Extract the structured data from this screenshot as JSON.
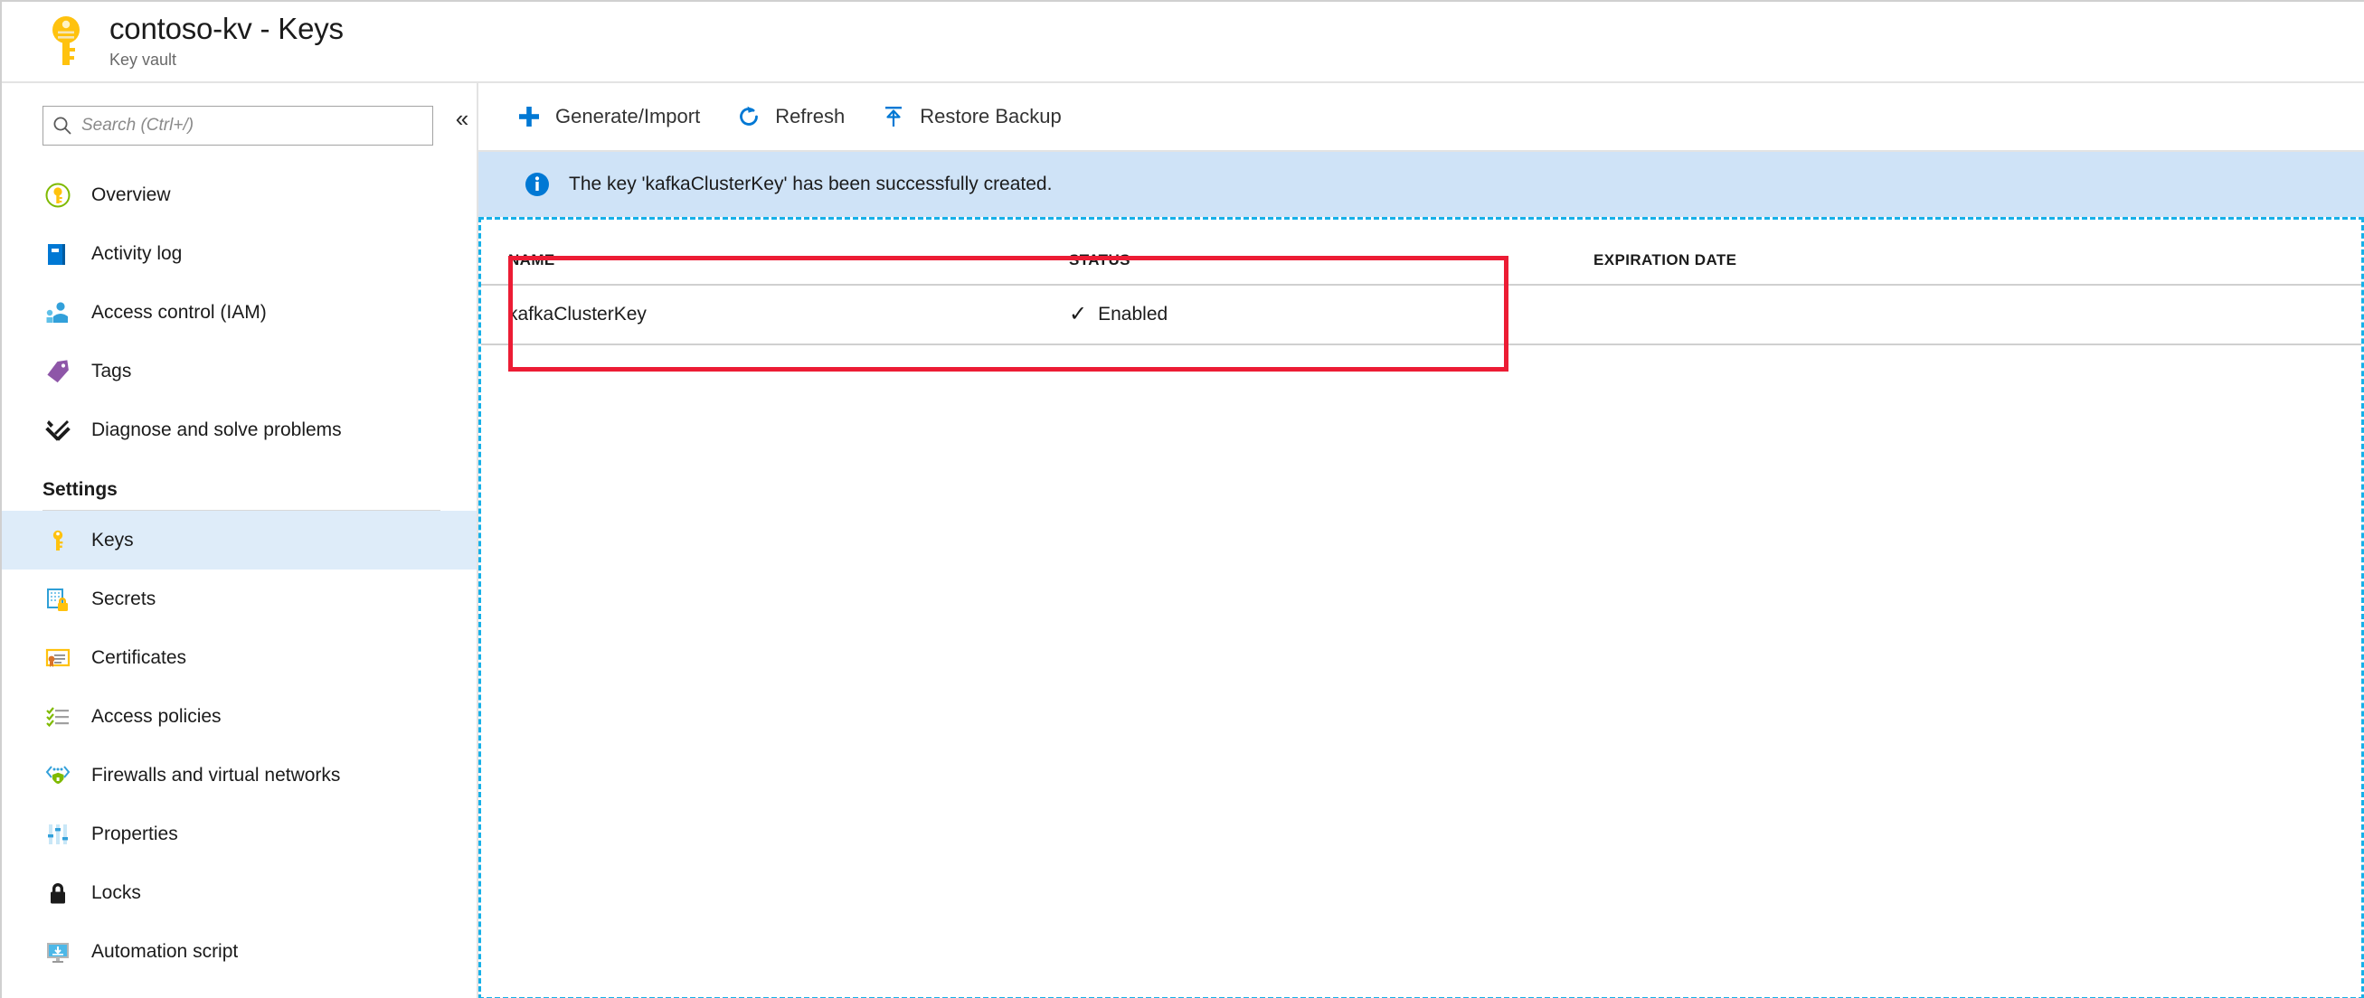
{
  "header": {
    "title": "contoso-kv - Keys",
    "subtitle": "Key vault",
    "icon": "key-icon"
  },
  "sidebar": {
    "search": {
      "placeholder": "Search (Ctrl+/)",
      "value": "",
      "icon": "search-icon"
    },
    "collapse_label": "«",
    "items": [
      {
        "label": "Overview",
        "icon": "overview-key-circle-icon",
        "selected": false
      },
      {
        "label": "Activity log",
        "icon": "activity-log-book-icon",
        "selected": false
      },
      {
        "label": "Access control (IAM)",
        "icon": "access-control-people-icon",
        "selected": false
      },
      {
        "label": "Tags",
        "icon": "tag-icon",
        "selected": false
      },
      {
        "label": "Diagnose and solve problems",
        "icon": "wrench-screwdriver-icon",
        "selected": false
      }
    ],
    "section_title": "Settings",
    "settings_items": [
      {
        "label": "Keys",
        "icon": "key-icon",
        "selected": true
      },
      {
        "label": "Secrets",
        "icon": "secrets-lock-icon",
        "selected": false
      },
      {
        "label": "Certificates",
        "icon": "certificate-icon",
        "selected": false
      },
      {
        "label": "Access policies",
        "icon": "checklist-icon",
        "selected": false
      },
      {
        "label": "Firewalls and virtual networks",
        "icon": "firewall-network-icon",
        "selected": false
      },
      {
        "label": "Properties",
        "icon": "sliders-icon",
        "selected": false
      },
      {
        "label": "Locks",
        "icon": "lock-icon",
        "selected": false
      },
      {
        "label": "Automation script",
        "icon": "automation-script-monitor-icon",
        "selected": false
      }
    ]
  },
  "toolbar": {
    "commands": [
      {
        "label": "Generate/Import",
        "icon": "plus-icon"
      },
      {
        "label": "Refresh",
        "icon": "refresh-icon"
      },
      {
        "label": "Restore Backup",
        "icon": "upload-arrow-icon"
      }
    ]
  },
  "notification": {
    "icon": "info-icon",
    "message": "The key 'kafkaClusterKey' has been successfully created."
  },
  "table": {
    "columns": [
      "NAME",
      "STATUS",
      "EXPIRATION DATE"
    ],
    "rows": [
      {
        "name": "kafkaClusterKey",
        "status": "Enabled",
        "status_icon": "checkmark-icon",
        "expiration_date": ""
      }
    ]
  },
  "annotations": {
    "highlight_color": "#ec1c34",
    "content_outline_color": "#16b0e8"
  },
  "colors": {
    "accent_blue": "#0078d4",
    "selected_nav_bg": "#deecf9",
    "notice_bg": "#cfe3f7",
    "key_yellow": "#ffc20e"
  }
}
